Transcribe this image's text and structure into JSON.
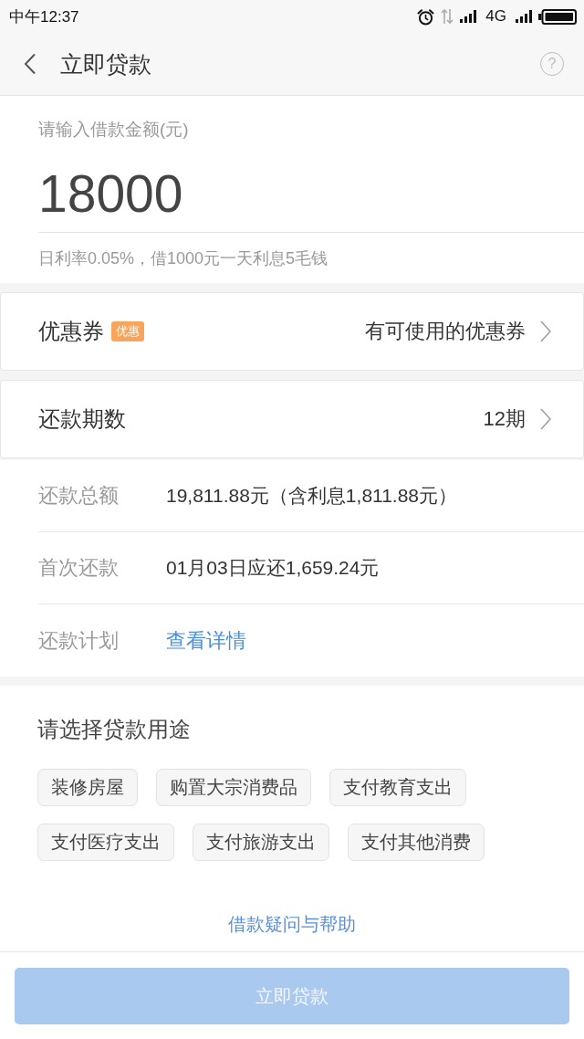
{
  "status_bar": {
    "time": "中午12:37",
    "network": "4G"
  },
  "nav": {
    "title": "立即贷款",
    "help": "?"
  },
  "amount": {
    "label": "请输入借款金额(元)",
    "value": "18000",
    "note": "日利率0.05%，借1000元一天利息5毛钱"
  },
  "option_rows": [
    {
      "label": "优惠券",
      "tag": "优惠",
      "value": "有可使用的优惠券"
    },
    {
      "label": "还款期数",
      "value": "12期"
    }
  ],
  "details": [
    {
      "kind": "text",
      "label": "还款总额",
      "value": "19,811.88元（含利息1,811.88元）"
    },
    {
      "kind": "text",
      "label": "首次还款",
      "value": "01月03日应还1,659.24元"
    },
    {
      "kind": "link",
      "label": "还款计划",
      "value": "查看详情"
    }
  ],
  "purpose": {
    "title": "请选择贷款用途",
    "options": [
      {
        "label": "装修房屋",
        "selected": false
      },
      {
        "label": "购置大宗消费品",
        "selected": false
      },
      {
        "label": "支付教育支出",
        "selected": false
      },
      {
        "label": "支付医疗支出",
        "selected": false
      },
      {
        "label": "支付旅游支出",
        "selected": false
      },
      {
        "label": "支付其他消费",
        "selected": false
      }
    ]
  },
  "help_link": "借款疑问与帮助",
  "submit": {
    "label": "立即贷款",
    "disabled": true
  }
}
